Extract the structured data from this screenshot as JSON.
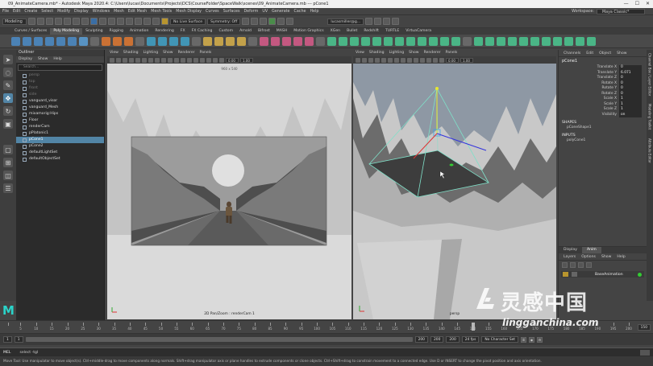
{
  "window": {
    "title": "09_AnimateCamera.mb* - Autodesk Maya 2020.4: C:\\Users\\lucas\\Documents\\Projects\\DCS\\CourseFolder\\SpaceWalk\\scenes\\09_AnimateCamera.mb  ---  pCone1",
    "controls": [
      "—",
      "☐",
      "✕"
    ]
  },
  "menubar": {
    "items": [
      "File",
      "Edit",
      "Create",
      "Select",
      "Modify",
      "Display",
      "Windows",
      "Mesh",
      "Edit Mesh",
      "Mesh Tools",
      "Mesh Display",
      "Curves",
      "Surfaces",
      "Deform",
      "UV",
      "Generate",
      "Cache",
      "Help"
    ],
    "workspace_label": "Workspace:",
    "workspace_value": "Maya Classic*"
  },
  "statusline": {
    "mode": "Modeling",
    "no_live_surface": "No Live Surface",
    "symmetry": "Symmetry: Off",
    "user": "lucasmiller@g..."
  },
  "shelf": {
    "tabs": [
      "Curves / Surfaces",
      "Poly Modeling",
      "Sculpting",
      "Rigging",
      "Animation",
      "Rendering",
      "FX",
      "FX Caching",
      "Custom",
      "Arnold",
      "Bifrost",
      "MASH",
      "Motion Graphics",
      "XGen",
      "Bullet",
      "Redshift",
      "TURTLE",
      "VirtuaCamera"
    ],
    "active_tab": 1
  },
  "outliner": {
    "title": "Outliner",
    "menu": [
      "Display",
      "Show",
      "Help"
    ],
    "search_placeholder": "Search...",
    "items": [
      {
        "label": "persp",
        "state": "dim"
      },
      {
        "label": "top",
        "state": "dim"
      },
      {
        "label": "front",
        "state": "dim"
      },
      {
        "label": "side",
        "state": "dim"
      },
      {
        "label": "vanguard_visor",
        "state": "normal"
      },
      {
        "label": "vanguard_Mesh",
        "state": "normal"
      },
      {
        "label": "mixamorig:Hips",
        "state": "normal"
      },
      {
        "label": "Floor",
        "state": "normal"
      },
      {
        "label": "renderCam",
        "state": "normal"
      },
      {
        "label": "pPlatonic1",
        "state": "normal"
      },
      {
        "label": "pCone1",
        "state": "selected"
      },
      {
        "label": "pCone2",
        "state": "normal"
      },
      {
        "label": "defaultLightSet",
        "state": "normal"
      },
      {
        "label": "defaultObjectSet",
        "state": "normal"
      }
    ]
  },
  "viewport_left": {
    "menu": [
      "View",
      "Shading",
      "Lighting",
      "Show",
      "Renderer",
      "Panels"
    ],
    "near_value": "0.00",
    "far_value": "1.00",
    "resolution": "960 x 540",
    "label": "2D Pan/Zoom : renderCam 1"
  },
  "viewport_right": {
    "menu": [
      "View",
      "Shading",
      "Lighting",
      "Show",
      "Renderer",
      "Panels"
    ],
    "near_value": "0.00",
    "far_value": "1.00",
    "label": "persp"
  },
  "channelbox": {
    "menu": [
      "Channels",
      "Edit",
      "Object",
      "Show"
    ],
    "object": "pCone1",
    "attributes": [
      {
        "name": "Translate X",
        "value": "0"
      },
      {
        "name": "Translate Y",
        "value": "6.071"
      },
      {
        "name": "Translate Z",
        "value": "0"
      },
      {
        "name": "Rotate X",
        "value": "0"
      },
      {
        "name": "Rotate Y",
        "value": "0"
      },
      {
        "name": "Rotate Z",
        "value": "0"
      },
      {
        "name": "Scale X",
        "value": "1"
      },
      {
        "name": "Scale Y",
        "value": "1"
      },
      {
        "name": "Scale Z",
        "value": "1"
      },
      {
        "name": "Visibility",
        "value": "on"
      }
    ],
    "shapes_header": "SHAPES",
    "shape_item": "pConeShape1",
    "inputs_header": "INPUTS",
    "input_item": "polyCone1"
  },
  "layers": {
    "tabs": [
      "Display",
      "Anim"
    ],
    "active_tab": 1,
    "menu": [
      "Layers",
      "Options",
      "Show",
      "Help"
    ],
    "layer_name": "BaseAnimation"
  },
  "sidetabs": [
    "Channel Box / Layer Editor",
    "Modeling Toolkit",
    "Attribute Editor"
  ],
  "timeslider": {
    "start": 1,
    "end": 200,
    "current": 150,
    "tick_labels": [
      "5",
      "10",
      "15",
      "20",
      "25",
      "30",
      "35",
      "40",
      "45",
      "50",
      "55",
      "60",
      "65",
      "70",
      "75",
      "80",
      "85",
      "90",
      "95",
      "100",
      "105",
      "110",
      "115",
      "120",
      "125",
      "130",
      "135",
      "140",
      "145",
      "150",
      "155",
      "160",
      "165",
      "170",
      "175",
      "180",
      "185",
      "190",
      "195",
      "200"
    ],
    "current_field": "150"
  },
  "range": {
    "start_field": "1",
    "inner_start": "1",
    "inner_end": "200",
    "end_field": "200",
    "end_field2": "200",
    "fps": "24 fps",
    "anim_layer": "No Character Set"
  },
  "cmdline": {
    "lang": "MEL",
    "text": "select -tgl"
  },
  "helpline": {
    "text": "Move Tool: Use manipulator to move object(s). Ctrl+middle-drag to move components along normals. Shift+drag manipulator axis or plane handles to extrude components or clone objects. Ctrl+Shift+drag to constrain movement to a connected edge. Use D or INSERT to change the pivot position and axis orientation."
  },
  "watermark": {
    "cn": "灵感中国",
    "url": "lingganchina.com"
  },
  "colors": {
    "selection": "#5285a6",
    "accent": "#2ad3c9",
    "cone_wire": "#7fe0c8"
  }
}
